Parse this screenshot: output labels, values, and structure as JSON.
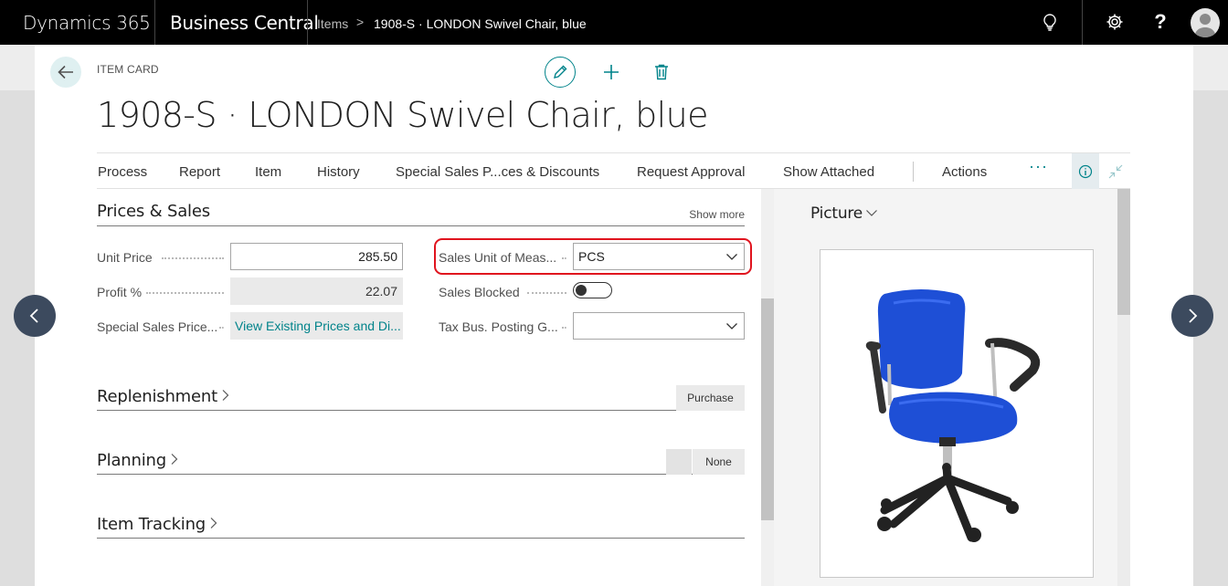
{
  "topbar": {
    "brand": "Dynamics 365",
    "app": "Business Central",
    "breadcrumb": [
      "Items",
      "1908-S · LONDON Swivel Chair, blue"
    ],
    "breadcrumb_sep": ">"
  },
  "header": {
    "caption": "ITEM CARD",
    "title": "1908-S · LONDON Swivel Chair, blue"
  },
  "actions": {
    "items": [
      "Process",
      "Report",
      "Item",
      "History",
      "Special Sales P...ces & Discounts",
      "Request Approval",
      "Show Attached"
    ],
    "secondary": "Actions",
    "more": "···"
  },
  "prices_sales": {
    "title": "Prices & Sales",
    "show_more": "Show more",
    "unit_price_label": "Unit Price",
    "unit_price": "285.50",
    "profit_label": "Profit %",
    "profit": "22.07",
    "special_label": "Special Sales Price...",
    "special_value": "View Existing Prices and Di...",
    "sales_uom_label": "Sales Unit of Meas...",
    "sales_uom": "PCS",
    "sales_blocked_label": "Sales Blocked",
    "sales_blocked": false,
    "tax_label": "Tax Bus. Posting G...",
    "tax_value": ""
  },
  "replenishment": {
    "title": "Replenishment",
    "summary": "Purchase"
  },
  "planning": {
    "title": "Planning",
    "summary": "None"
  },
  "item_tracking": {
    "title": "Item Tracking"
  },
  "factbox": {
    "title": "Picture"
  },
  "colors": {
    "accent": "#00838a",
    "highlight": "#e0141e",
    "chair": "#1e4fd6"
  }
}
